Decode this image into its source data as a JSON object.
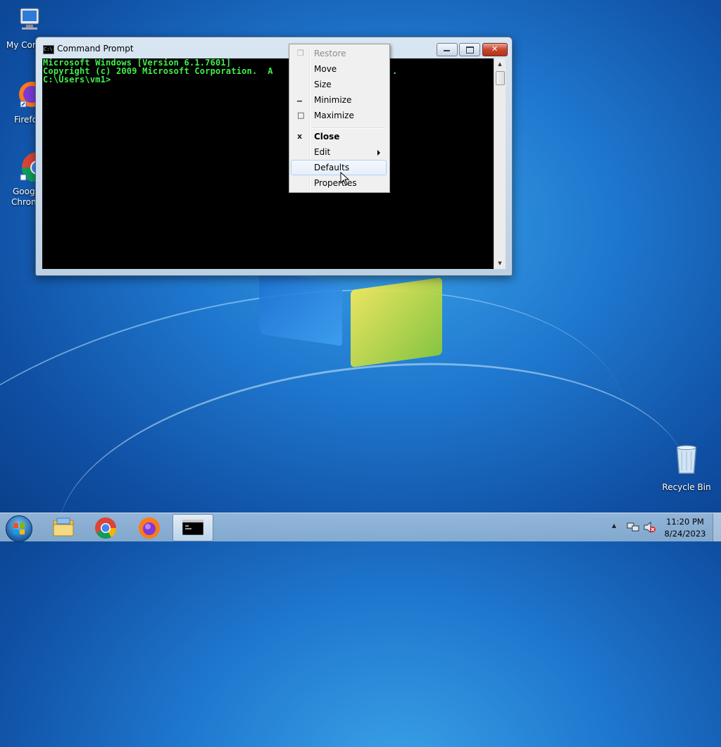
{
  "desktop": {
    "icons": [
      {
        "label": "My Comp"
      },
      {
        "label": "Firefo"
      },
      {
        "label": "Googl",
        "label2": "Chron"
      },
      {
        "label": "Recycle Bin"
      }
    ]
  },
  "window": {
    "title": "Command Prompt",
    "icon_text": "C:\\",
    "console_lines": [
      "Microsoft Windows [Version 6.1.7601]",
      "Copyright (c) 2009 Microsoft Corporation.  A",
      "",
      "C:\\Users\\vm1>"
    ],
    "console_line2_tail": "."
  },
  "context_menu": {
    "items": [
      {
        "label": "Restore",
        "glyph": "❐"
      },
      {
        "label": "Move",
        "glyph": ""
      },
      {
        "label": "Size",
        "glyph": ""
      },
      {
        "label": "Minimize",
        "glyph": "▁"
      },
      {
        "label": "Maximize",
        "glyph": "□"
      },
      {
        "label": "Close",
        "glyph": "x"
      },
      {
        "label": "Edit",
        "glyph": ""
      },
      {
        "label": "Defaults",
        "glyph": ""
      },
      {
        "label": "Properties",
        "glyph": ""
      }
    ]
  },
  "taskbar": {
    "clock_time": "11:20 PM",
    "clock_date": "8/24/2023",
    "tray_up": "▲"
  },
  "colors": {
    "console_text": "#41f04a",
    "menu_highlight": "#aecff7"
  }
}
